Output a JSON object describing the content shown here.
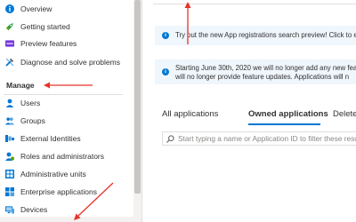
{
  "sidebar": {
    "items": [
      {
        "label": "Overview",
        "icon": "info-icon"
      },
      {
        "label": "Getting started",
        "icon": "rocket-icon"
      },
      {
        "label": "Preview features",
        "icon": "preview-icon"
      },
      {
        "label": "Diagnose and solve problems",
        "icon": "wrench-icon"
      }
    ],
    "manage_header": "Manage",
    "manage_items": [
      {
        "label": "Users",
        "icon": "user-icon"
      },
      {
        "label": "Groups",
        "icon": "groups-icon"
      },
      {
        "label": "External Identities",
        "icon": "external-identities-icon"
      },
      {
        "label": "Roles and administrators",
        "icon": "roles-icon"
      },
      {
        "label": "Administrative units",
        "icon": "admin-units-icon"
      },
      {
        "label": "Enterprise applications",
        "icon": "enterprise-apps-icon"
      },
      {
        "label": "Devices",
        "icon": "devices-icon"
      }
    ]
  },
  "main": {
    "banner1": "Try out the new App registrations search preview! Click to e",
    "banner2_line1": "Starting June 30th, 2020 we will no longer add any new fea",
    "banner2_line2": "will no longer provide feature updates. Applications will n",
    "tabs": [
      {
        "label": "All applications",
        "active": false
      },
      {
        "label": "Owned applications",
        "active": true
      },
      {
        "label": "Deleted ap",
        "active": false
      }
    ],
    "search_placeholder": "Start typing a name or Application ID to filter these resu"
  },
  "colors": {
    "accent": "#0078d4",
    "annotation": "#e8332a",
    "banner_bg": "#eff6fc"
  }
}
